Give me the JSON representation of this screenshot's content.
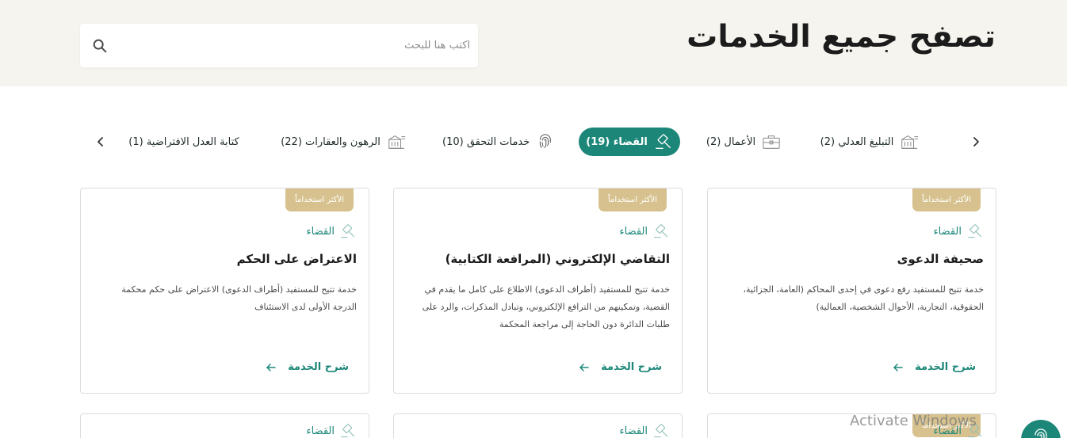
{
  "header": {
    "title": "تصفح جميع الخدمات",
    "search_placeholder": "اكتب هنا للبحث",
    "search_icon": "search-icon"
  },
  "colors": {
    "accent": "#1c8779",
    "badge": "#d7c28f",
    "hero_bg": "#f6f4ee"
  },
  "tabs": [
    {
      "label": "التبليغ العدلي (2)",
      "icon": "notification-building-icon",
      "active": false
    },
    {
      "label": "الأعمال (2)",
      "icon": "briefcase-icon",
      "active": false
    },
    {
      "label": "القضاء (19)",
      "icon": "gavel-icon",
      "active": true
    },
    {
      "label": "خدمات التحقق (10)",
      "icon": "fingerprint-icon",
      "active": false
    },
    {
      "label": "الرهون والعقارات (22)",
      "icon": "building-icon",
      "active": false
    },
    {
      "label": "كتابة العدل الافتراضية (1)",
      "icon": "",
      "active": false
    }
  ],
  "cards": [
    {
      "badge": "الأكثر استخداماً",
      "category": "القضاء",
      "title": "صحيفة الدعوى",
      "description": "خدمة تتيح للمستفيد رفع دعوى في إحدى المحاكم (العامة، الجزائية، الحقوقية، التجارية، الأحوال الشخصية، العمالية)",
      "link": "شرح الخدمة"
    },
    {
      "badge": "الأكثر استخداماً",
      "category": "القضاء",
      "title": "التقاضي الإلكتروني (المرافعة الكتابية)",
      "description": "خدمة تتيح للمستفيد (أطراف الدعوى) الاطلاع على كامل ما يقدم في القضية، وتمكينهم من الترافع الإلكتروني، وتبادل المذكرات، والرد على طلبات الدائرة دون الحاجة إلى مراجعة المحكمة",
      "link": "شرح الخدمة"
    },
    {
      "badge": "الأكثر استخداماً",
      "category": "القضاء",
      "title": "الاعتراض على الحكم",
      "description": "خدمة تتيح للمستفيد (أطراف الدعوى) الاعتراض على حكم محكمة الدرجة الأولى لدى الاستئناف",
      "link": "شرح الخدمة"
    }
  ],
  "next_row": [
    {
      "badge": "الأكثر استخداماً",
      "category": "القضاء"
    },
    {
      "category": "القضاء"
    },
    {
      "category": "القضاء"
    }
  ],
  "watermark": "Activate Windows"
}
